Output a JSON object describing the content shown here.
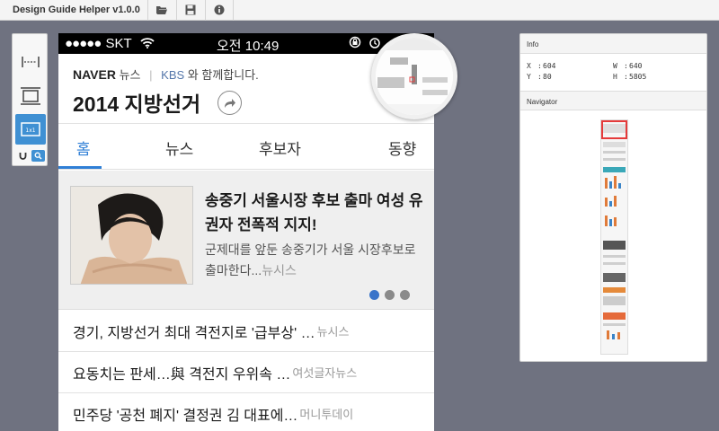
{
  "app": {
    "title": "Design Guide Helper v1.0.0",
    "toolbar": [
      {
        "name": "open-folder-icon"
      },
      {
        "name": "save-icon"
      },
      {
        "name": "info-icon"
      }
    ]
  },
  "palette": {
    "tools": [
      "horizontal-measure-icon",
      "box-measure-icon",
      "ruler-box-icon"
    ],
    "small_tools": [
      "magnet-icon",
      "zoom-icon"
    ]
  },
  "phone": {
    "statusbar": {
      "signal": "●●●●●",
      "carrier": "SKT",
      "time": "오전 10:49"
    },
    "header": {
      "brand": "NAVER",
      "brand_sub": "뉴스",
      "partner": "KBS",
      "partner_text": "와 함께합니다.",
      "title": "2014 지방선거"
    },
    "tabs": [
      {
        "label": "홈",
        "active": true
      },
      {
        "label": "뉴스",
        "active": false
      },
      {
        "label": "후보자",
        "active": false
      },
      {
        "label": "동향",
        "active": false
      }
    ],
    "featured": {
      "headline": "송중기 서울시장 후보 출마 여성 유권자 전폭적 지지!",
      "summary": "군제대를 앞둔 송중기가 서울 시장후보로 출마한다...",
      "source": "뉴시스",
      "carousel_total": 3,
      "carousel_active": 0
    },
    "news": [
      {
        "title": "경기, 지방선거 최대 격전지로 '급부상' …",
        "source": "뉴시스"
      },
      {
        "title": "요동치는 판세…與 격전지 우위속 …",
        "source": "여섯글자뉴스"
      },
      {
        "title": "민주당 '공천 폐지' 결정권 김 대표에…",
        "source": "머니투데이"
      }
    ]
  },
  "info_panel": {
    "title": "Info",
    "x_label": "X",
    "x": "604",
    "y_label": "Y",
    "y": "80",
    "w_label": "W",
    "w": "640",
    "h_label": "H",
    "h": "5805"
  },
  "navigator": {
    "title": "Navigator"
  },
  "colors": {
    "accent": "#2f7fd6",
    "tool_active": "#3f90d3",
    "viewport": "#e53b3b",
    "background": "#6f7280"
  }
}
